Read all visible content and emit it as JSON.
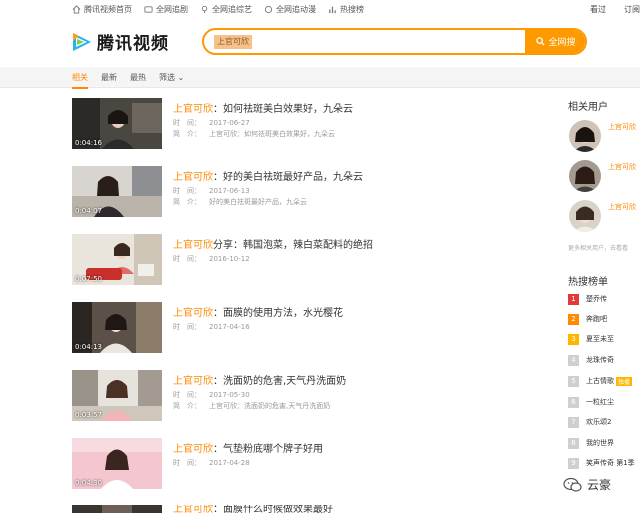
{
  "topnav": {
    "items": [
      "腾讯视频首页",
      "全网追剧",
      "全网追综艺",
      "全网追动漫",
      "热搜榜"
    ],
    "right": [
      "看过",
      "订阅"
    ]
  },
  "header": {
    "logo_text": "腾讯视频",
    "search_value": "上官可欣",
    "search_button": "全网搜"
  },
  "tabs": [
    "相关",
    "最新",
    "最热",
    "筛选"
  ],
  "results": [
    {
      "highlight": "上官可欣",
      "title": "：如何祛斑美白效果好，九朵云",
      "time_label": "时　间：",
      "time": "2017-06-27",
      "intro_label": "简　介：",
      "intro": "上官可欣：如何祛斑美白效果好，九朵云",
      "duration": "0:04:16"
    },
    {
      "highlight": "上官可欣",
      "title": "：好的美白祛斑最好产品，九朵云",
      "time_label": "时　间：",
      "time": "2017-06-13",
      "intro_label": "简　介：",
      "intro": "好的美白祛斑最好产品，九朵云",
      "duration": "0:04:07"
    },
    {
      "highlight": "上官可欣",
      "title": "分享：韩国泡菜，辣白菜配料的绝招",
      "time_label": "时　间：",
      "time": "2016-10-12",
      "intro_label": "",
      "intro": "",
      "duration": "0:07:50"
    },
    {
      "highlight": "上官可欣",
      "title": "：面膜的使用方法，水光樱花",
      "time_label": "时　间：",
      "time": "2017-04-16",
      "intro_label": "",
      "intro": "",
      "duration": "0:04:13"
    },
    {
      "highlight": "上官可欣",
      "title": "：洗面奶的危害,天气丹洗面奶",
      "time_label": "时　间：",
      "time": "2017-05-30",
      "intro_label": "简　介：",
      "intro": "上官可欣：洗面奶的危害,天气丹洗面奶",
      "duration": "0:03:57"
    },
    {
      "highlight": "上官可欣",
      "title": "：气垫粉底哪个牌子好用",
      "time_label": "时　间：",
      "time": "2017-04-28",
      "intro_label": "",
      "intro": "",
      "duration": "0:04:30"
    },
    {
      "highlight": "上官可欣",
      "title": "：面膜什么时候做效果最好",
      "time_label": "",
      "time": "",
      "intro_label": "",
      "intro": "",
      "duration": ""
    }
  ],
  "sidebar": {
    "related_title": "相关用户",
    "users": [
      "上官可欣",
      "上官可欣",
      "上官可欣"
    ],
    "more_users": "更多相关用户，去看看",
    "hot_title": "热搜榜单",
    "hot": [
      {
        "rank": "1",
        "name": "楚乔传",
        "color": "#e4393c",
        "tag": ""
      },
      {
        "rank": "2",
        "name": "奔跑吧",
        "color": "#ff8a00",
        "tag": ""
      },
      {
        "rank": "3",
        "name": "夏至未至",
        "color": "#ffb400",
        "tag": ""
      },
      {
        "rank": "4",
        "name": "龙珠传奇",
        "color": "#cfcfcf",
        "tag": ""
      },
      {
        "rank": "5",
        "name": "上古情歌",
        "color": "#cfcfcf",
        "tag": "独播"
      },
      {
        "rank": "6",
        "name": "一粒红尘",
        "color": "#cfcfcf",
        "tag": ""
      },
      {
        "rank": "7",
        "name": "欢乐颂2",
        "color": "#cfcfcf",
        "tag": ""
      },
      {
        "rank": "8",
        "name": "我的世界",
        "color": "#cfcfcf",
        "tag": ""
      },
      {
        "rank": "9",
        "name": "笑声传奇 第1季",
        "color": "#cfcfcf",
        "tag": ""
      }
    ]
  },
  "watermark": "云豪",
  "colors": {
    "accent": "#ff9900",
    "highlight": "#ff8a00"
  }
}
